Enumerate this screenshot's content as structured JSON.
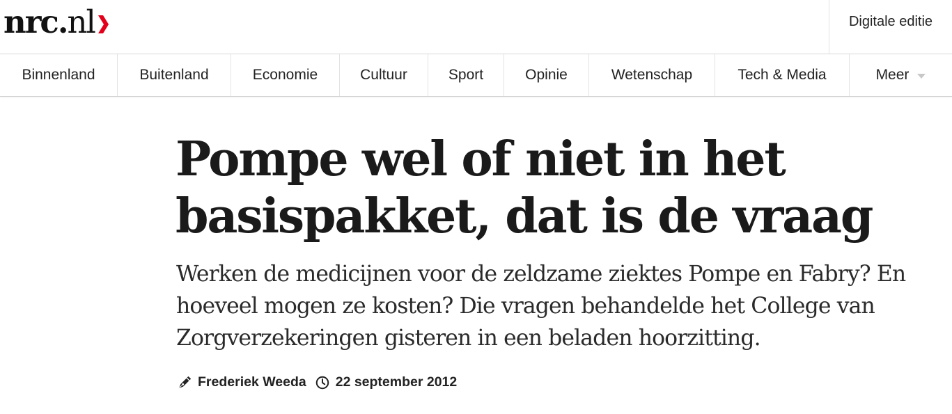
{
  "header": {
    "logo": {
      "main": "nrc.",
      "tld": "nl",
      "accent_color": "#e2001a"
    },
    "digital_edition_label": "Digitale editie"
  },
  "nav": {
    "items": [
      {
        "label": "Binnenland"
      },
      {
        "label": "Buitenland"
      },
      {
        "label": "Economie"
      },
      {
        "label": "Cultuur"
      },
      {
        "label": "Sport"
      },
      {
        "label": "Opinie"
      },
      {
        "label": "Wetenschap"
      },
      {
        "label": "Tech & Media"
      },
      {
        "label": "Meer",
        "icon": "chevron-down-icon"
      }
    ]
  },
  "article": {
    "headline": "Pompe wel of niet in het basispakket, dat is de vraag",
    "intro": "Werken de medicijnen voor de zeldzame ziektes Pompe en Fabry? En hoeveel mogen ze kosten? Die vragen behandelde het College van Zorgverzekeringen gisteren in een beladen hoorzitting.",
    "author": "Frederiek Weeda",
    "author_icon": "pen-icon",
    "date": "22 september 2012",
    "date_icon": "clock-icon"
  }
}
